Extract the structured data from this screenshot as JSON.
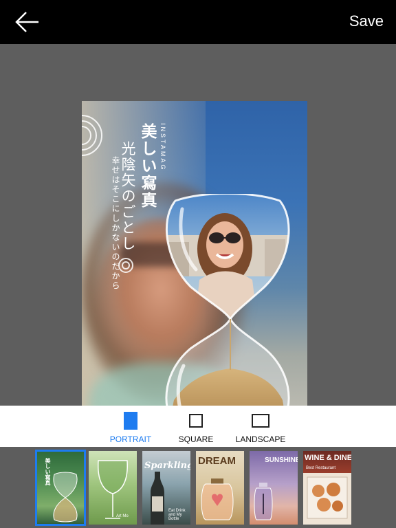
{
  "toolbar": {
    "back_icon": "arrow-left-icon",
    "save_label": "Save"
  },
  "poster": {
    "brand": "INSTAMAG",
    "title": "美しい寫真",
    "subtitle": "光陰矢のごとし",
    "caption": "幸せはそこにしかないのだから"
  },
  "layout_options": [
    {
      "label": "PORTRAIT",
      "active": true
    },
    {
      "label": "SQUARE",
      "active": false
    },
    {
      "label": "LANDSCAPE",
      "active": false
    }
  ],
  "templates": [
    {
      "name": "hourglass",
      "title": "美しい寫真",
      "selected": true
    },
    {
      "name": "wine-glass",
      "title": "",
      "caption": "Art Mo",
      "selected": false
    },
    {
      "name": "sparkling",
      "title": "Sparkling",
      "caption": "Eat Drink and My Bottle",
      "selected": false
    },
    {
      "name": "dream",
      "title": "DREAM",
      "selected": false
    },
    {
      "name": "sunshine",
      "title": "SUNSHINE",
      "selected": false
    },
    {
      "name": "wine-dine",
      "title": "WINE & DINE",
      "caption": "Best Restaurant",
      "selected": false
    }
  ],
  "colors": {
    "accent": "#1e7cf0",
    "topbar": "#000000",
    "workspace": "#5f5f5f"
  }
}
